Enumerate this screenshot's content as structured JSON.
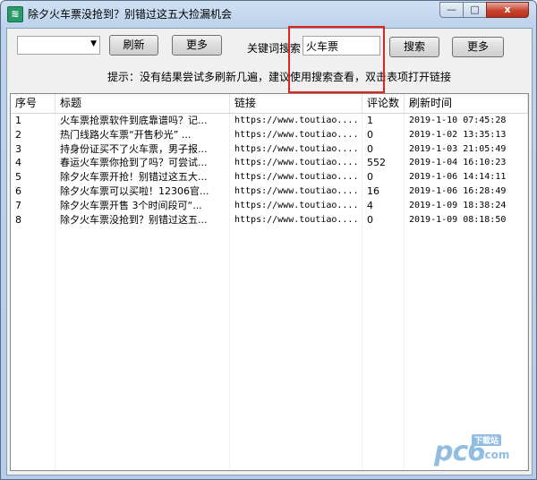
{
  "window": {
    "title": "除夕火车票没抢到？别错过这五大捡漏机会",
    "icon": "app-icon",
    "controls": {
      "min": "—",
      "max": "□",
      "close": "x"
    }
  },
  "toolbar": {
    "combo_value": "",
    "refresh_label": "刷新",
    "more_label_1": "更多",
    "keyword_label": "关键词搜索",
    "keyword_value": "火车票",
    "search_label": "搜索",
    "more_label_2": "更多",
    "hint": "提示：没有结果尝试多刷新几遍，建议使用搜索查看，双击表项打开链接"
  },
  "table": {
    "columns": [
      "序号",
      "标题",
      "链接",
      "评论数",
      "刷新时间"
    ],
    "rows": [
      [
        "1",
        "火车票抢票软件到底靠谱吗？记...",
        "https://www.toutiao....",
        "1",
        "2019-1-10 07:45:28"
      ],
      [
        "2",
        "热门线路火车票“开售秒光” ...",
        "https://www.toutiao....",
        "0",
        "2019-1-02 13:35:13"
      ],
      [
        "3",
        "持身份证买不了火车票，男子报...",
        "https://www.toutiao....",
        "0",
        "2019-1-03 21:05:49"
      ],
      [
        "4",
        "春运火车票你抢到了吗？可尝试...",
        "https://www.toutiao....",
        "552",
        "2019-1-04 16:10:23"
      ],
      [
        "5",
        "除夕火车票开抢！别错过这五大...",
        "https://www.toutiao....",
        "0",
        "2019-1-06 14:14:11"
      ],
      [
        "6",
        "除夕火车票可以买啦！12306官...",
        "https://www.toutiao....",
        "16",
        "2019-1-06 16:28:49"
      ],
      [
        "7",
        "除夕火车票开售 3个时间段可“...",
        "https://www.toutiao....",
        "4",
        "2019-1-09 18:38:24"
      ],
      [
        "8",
        "除夕火车票没抢到？别错过这五...",
        "https://www.toutiao....",
        "0",
        "2019-1-09 08:18:50"
      ]
    ]
  },
  "watermark": {
    "main": "pc6",
    "sub": "下载站",
    "domain": ".com"
  },
  "colors": {
    "highlight": "#e0241c",
    "watermark": "#7fb2dd"
  }
}
